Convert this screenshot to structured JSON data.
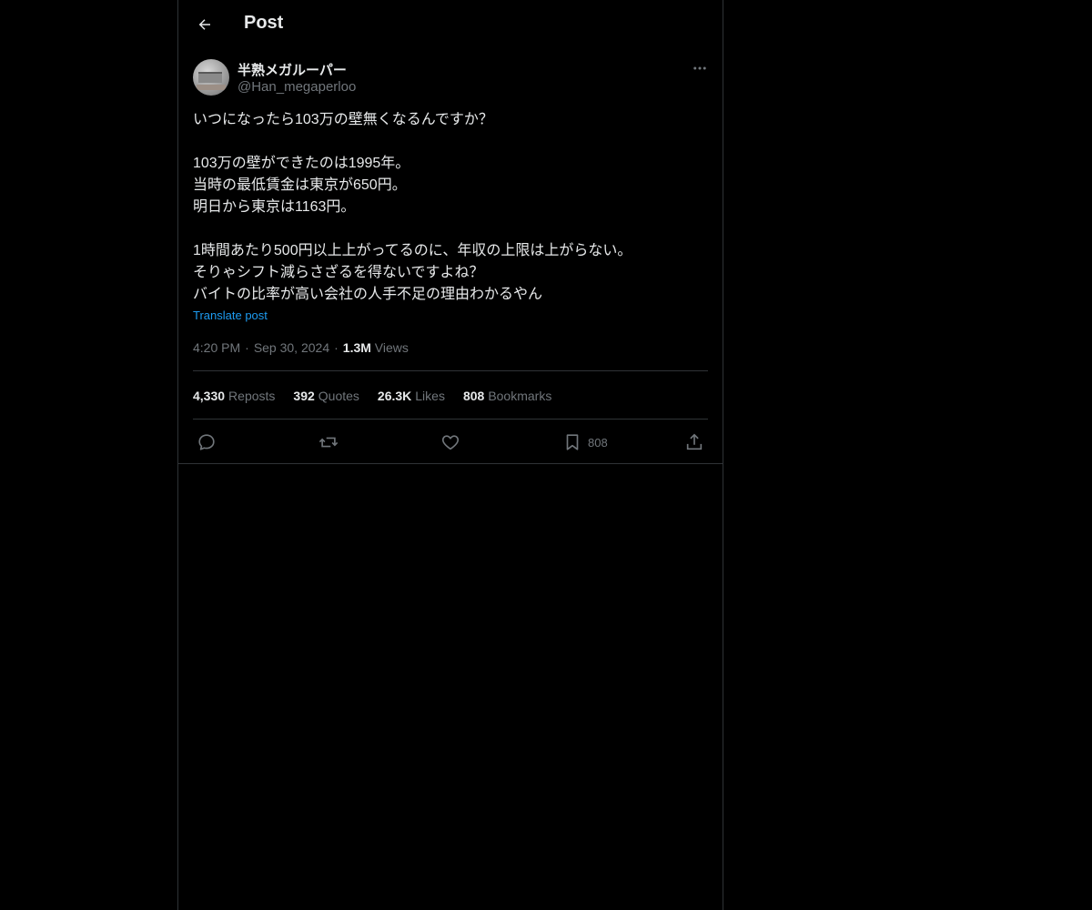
{
  "header": {
    "title": "Post"
  },
  "author": {
    "display_name": "半熟メガルーパー",
    "handle": "@Han_megaperloo"
  },
  "post": {
    "lines": [
      "いつになったら103万の壁無くなるんですか？",
      "",
      "103万の壁ができたのは1995年。",
      "当時の最低賃金は東京が650円。",
      "明日から東京は1163円。",
      "",
      "1時間あたり500円以上上がってるのに、年収の上限は上がらない。",
      "そりゃシフト減らさざるを得ないですよね？",
      "バイトの比率が高い会社の人手不足の理由わかるやん"
    ],
    "translate_label": "Translate post",
    "time": "4:20 PM",
    "date": "Sep 30, 2024",
    "views_count": "1.3M",
    "views_label": "Views",
    "separator": "·"
  },
  "stats": {
    "reposts": {
      "count": "4,330",
      "label": "Reposts"
    },
    "quotes": {
      "count": "392",
      "label": "Quotes"
    },
    "likes": {
      "count": "26.3K",
      "label": "Likes"
    },
    "bookmarks": {
      "count": "808",
      "label": "Bookmarks"
    }
  },
  "actions": {
    "bookmark_count": "808"
  },
  "icons": {
    "back": "arrow-left-icon",
    "more": "more-horizontal-icon",
    "reply": "reply-icon",
    "repost": "repost-icon",
    "like": "heart-icon",
    "bookmark": "bookmark-icon",
    "share": "share-icon"
  },
  "colors": {
    "background": "#000000",
    "text": "#e7e9ea",
    "secondary": "#71767b",
    "link": "#1d9bf0",
    "border": "#2f3336"
  }
}
